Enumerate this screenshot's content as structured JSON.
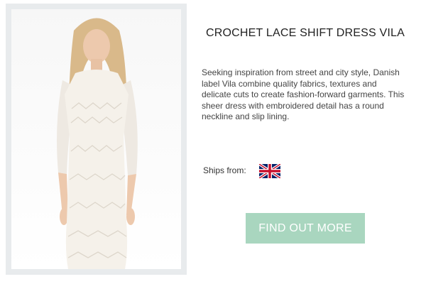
{
  "product": {
    "title": "CROCHET LACE SHIFT DRESS VILA",
    "description": "Seeking inspiration from street and city style, Danish label Vila combine quality fabrics, textures and delicate cuts to create fashion-forward garments. This sheer dress with embroidered detail has a round neckline and slip lining.",
    "ships_label": "Ships from:",
    "ships_flag_icon": "uk-flag-icon",
    "cta_label": "FIND OUT MORE"
  },
  "colors": {
    "cta_background": "#a9d6bf",
    "photo_frame": "#e8ebed"
  }
}
